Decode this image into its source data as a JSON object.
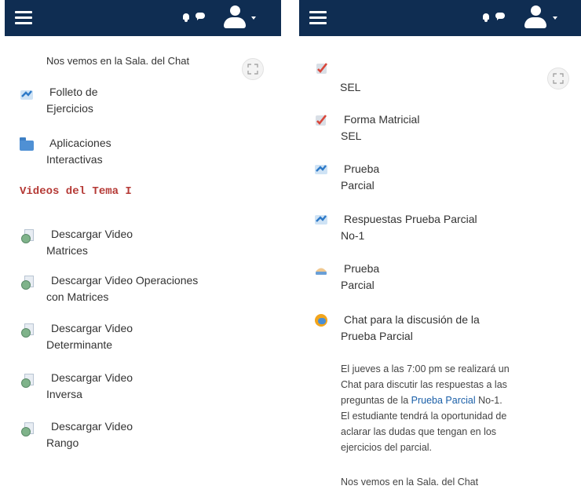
{
  "left_panel": {
    "top_text": "Nos vemos en la Sala.  del Chat",
    "items_top": [
      {
        "icon": "quiz-icon",
        "line1": "Folleto de",
        "line2": "Ejercicios"
      },
      {
        "icon": "folder-icon",
        "line1": "Aplicaciones",
        "line2": "Interactivas"
      }
    ],
    "section_heading": "Videos del Tema I",
    "videos": [
      {
        "icon": "file-icon",
        "line1": "Descargar Video",
        "line2": "Matrices"
      },
      {
        "icon": "file-icon",
        "line1": "Descargar Video Operaciones",
        "line2": "con Matrices"
      },
      {
        "icon": "file-icon",
        "line1": "Descargar Video",
        "line2": "Determinante"
      },
      {
        "icon": "file-icon",
        "line1": "Descargar Video",
        "line2": "Inversa"
      },
      {
        "icon": "file-icon",
        "line1": "Descargar Video",
        "line2": "Rango"
      }
    ]
  },
  "right_panel": {
    "item0": {
      "icon": "assignment-icon",
      "line2": "SEL"
    },
    "items": [
      {
        "icon": "assignment-icon",
        "line1": "Forma Matricial",
        "line2": "SEL"
      },
      {
        "icon": "quiz-icon",
        "line1": "Prueba",
        "line2": "Parcial"
      },
      {
        "icon": "quiz-icon",
        "line1": "Respuestas Prueba Parcial",
        "line2": "No-1"
      },
      {
        "icon": "lesson-icon",
        "line1": "Prueba",
        "line2": "Parcial"
      },
      {
        "icon": "chat-activity-icon",
        "line1": "Chat para la discusión de la",
        "line2": "Prueba Parcial"
      }
    ],
    "description": {
      "line1": "El jueves a las 7:00 pm se realizará un",
      "line2": "Chat para discutir las respuestas a las",
      "line3_pre": "preguntas de la ",
      "line3_link": "Prueba Parcial",
      "line3_post": " No-1.",
      "line4": "El estudiante tendrá la oportunidad de",
      "line5": "aclarar las dudas que tengan en los",
      "line6": "ejercicios del parcial."
    },
    "closing": "Nos vemos en la Sala.  del Chat"
  },
  "colors": {
    "navbar": "#0f2d52",
    "heading": "#b53a36",
    "link": "#1a5fa8"
  }
}
